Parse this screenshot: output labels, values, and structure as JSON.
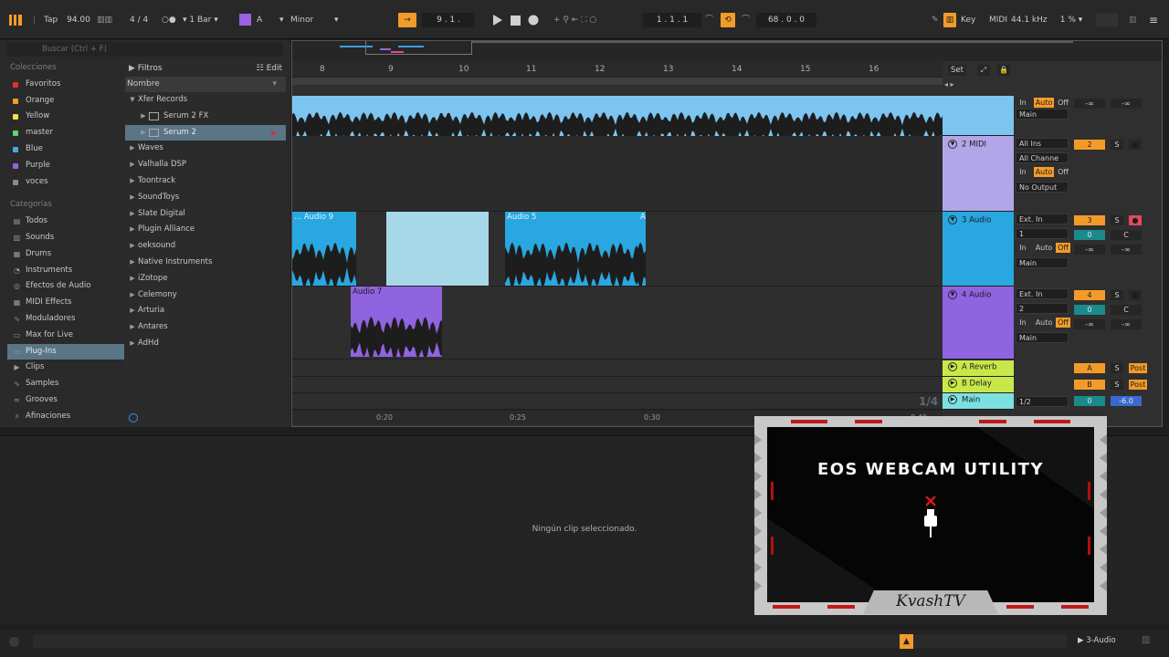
{
  "topbar": {
    "tap": "Tap",
    "tempo": "94.00",
    "signature": "4 / 4",
    "quantize": "1 Bar",
    "key_root": "A",
    "key_scale": "Minor",
    "position": "9 .  1 .",
    "loop_start": "1 .  1 .  1",
    "loop_length": "68 .  0 .  0",
    "key_label": "Key",
    "midi_label": "MIDI",
    "sample_rate": "44.1 kHz",
    "cpu": "1 %"
  },
  "browser": {
    "search_placeholder": "Buscar (Ctrl + F)",
    "collections_header": "Colecciones",
    "collections": [
      {
        "label": "Favoritos",
        "color": "#e0302c"
      },
      {
        "label": "Orange",
        "color": "#f39b2a"
      },
      {
        "label": "Yellow",
        "color": "#f2e14d"
      },
      {
        "label": "master",
        "color": "#5ed46a"
      },
      {
        "label": "Blue",
        "color": "#4aa8e0"
      },
      {
        "label": "Purple",
        "color": "#9a62e0"
      },
      {
        "label": "voces",
        "color": "#8a8a8a"
      }
    ],
    "categories_header": "Categorías",
    "categories": [
      {
        "label": "Todos",
        "icon": "grid-icon",
        "glyph": "▤"
      },
      {
        "label": "Sounds",
        "icon": "sounds-icon",
        "glyph": "▥"
      },
      {
        "label": "Drums",
        "icon": "drums-icon",
        "glyph": "▦"
      },
      {
        "label": "Instruments",
        "icon": "instrument-icon",
        "glyph": "◔"
      },
      {
        "label": "Efectos de Audio",
        "icon": "audio-fx-icon",
        "glyph": "◎"
      },
      {
        "label": "MIDI Effects",
        "icon": "midi-fx-icon",
        "glyph": "▦"
      },
      {
        "label": "Moduladores",
        "icon": "modulator-icon",
        "glyph": "∿"
      },
      {
        "label": "Max for Live",
        "icon": "max-icon",
        "glyph": "▭"
      },
      {
        "label": "Plug-Ins",
        "icon": "plugin-icon",
        "glyph": "▭"
      },
      {
        "label": "Clips",
        "icon": "clips-icon",
        "glyph": "▶"
      },
      {
        "label": "Samples",
        "icon": "samples-icon",
        "glyph": "∿"
      },
      {
        "label": "Grooves",
        "icon": "grooves-icon",
        "glyph": "≈"
      },
      {
        "label": "Afinaciones",
        "icon": "tuning-icon",
        "glyph": "♯"
      }
    ],
    "filters_label": "Filtros",
    "edit_label": "Edit",
    "name_col": "Nombre",
    "files": [
      {
        "label": "Xfer Records",
        "level": 0,
        "open": true
      },
      {
        "label": "Serum 2 FX",
        "level": 1,
        "plugin": true
      },
      {
        "label": "Serum 2",
        "level": 1,
        "plugin": true,
        "selected": true
      },
      {
        "label": "Waves",
        "level": 0
      },
      {
        "label": "Valhalla DSP",
        "level": 0
      },
      {
        "label": "Toontrack",
        "level": 0
      },
      {
        "label": "SoundToys",
        "level": 0
      },
      {
        "label": "Slate Digital",
        "level": 0
      },
      {
        "label": "Plugin Alliance",
        "level": 0
      },
      {
        "label": "oeksound",
        "level": 0
      },
      {
        "label": "Native Instruments",
        "level": 0
      },
      {
        "label": "iZotope",
        "level": 0
      },
      {
        "label": "Celemony",
        "level": 0
      },
      {
        "label": "Arturia",
        "level": 0
      },
      {
        "label": "Antares",
        "level": 0
      },
      {
        "label": "AdHd",
        "level": 0
      }
    ]
  },
  "arrangement": {
    "bars": [
      "8",
      "9",
      "10",
      "11",
      "12",
      "13",
      "14",
      "15",
      "16"
    ],
    "set_label": "Set",
    "time_labels": [
      "0:20",
      "0:25",
      "0:30",
      "0:40"
    ],
    "zoom_label": "1/4",
    "clips": [
      {
        "name": "... Audio 9",
        "track": 2
      },
      {
        "name": "Audio 5",
        "track": 2
      },
      {
        "name": "A",
        "track": 2
      },
      {
        "name": "Audio 7",
        "track": 3
      }
    ],
    "tracks": [
      {
        "title": "",
        "color": "#7cc5f0",
        "input": "Main",
        "monitor": [
          "In",
          "Auto",
          "Off"
        ],
        "vol_l": "-∞",
        "vol_r": "-∞"
      },
      {
        "title": "2 MIDI",
        "color": "#b1a7e8",
        "input": "All Ins",
        "channel": "All Channe",
        "monitor": [
          "In",
          "Auto",
          "Off"
        ],
        "output": "No Output",
        "num": "2",
        "solo": "S"
      },
      {
        "title": "3 Audio",
        "color": "#29a7e0",
        "input": "Ext. In",
        "channel": "1",
        "monitor": [
          "In",
          "Auto",
          "Off"
        ],
        "output": "Main",
        "num": "3",
        "solo": "S",
        "send": "0",
        "pan": "C",
        "vol_l": "-∞",
        "vol_r": "-∞"
      },
      {
        "title": "4 Audio",
        "color": "#9063e0",
        "input": "Ext. In",
        "channel": "2",
        "monitor": [
          "In",
          "Auto",
          "Off"
        ],
        "output": "Main",
        "num": "4",
        "solo": "S",
        "send": "0",
        "pan": "C",
        "vol_l": "-∞",
        "vol_r": "-∞"
      }
    ],
    "returns": [
      {
        "title": "A Reverb",
        "letter": "A",
        "solo": "S",
        "post": "Post"
      },
      {
        "title": "B Delay",
        "letter": "B",
        "solo": "S",
        "post": "Post"
      }
    ],
    "main": {
      "title": "Main",
      "routing": "1/2",
      "send": "0",
      "volume": "-6.0"
    }
  },
  "detail": {
    "empty_message": "Ningún clip seleccionado."
  },
  "statusbar": {
    "track_label": "3-Audio"
  },
  "webcam": {
    "title": "EOS WEBCAM UTILITY",
    "signature": "KvashTV"
  }
}
